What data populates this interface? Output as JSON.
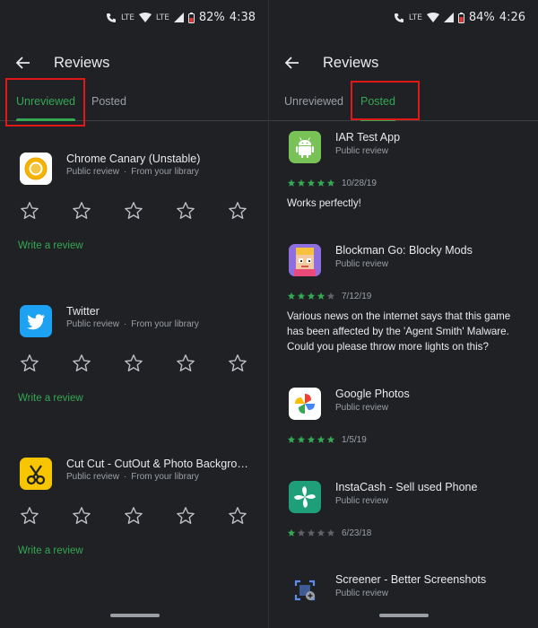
{
  "left": {
    "status": {
      "network": "LTE",
      "network2": "LTE",
      "battery": "82%",
      "time": "4:38"
    },
    "header": {
      "title": "Reviews"
    },
    "tabs": [
      {
        "label": "Unreviewed",
        "active": true
      },
      {
        "label": "Posted",
        "active": false
      }
    ],
    "items": [
      {
        "name": "Chrome Canary (Unstable)",
        "type": "Public review",
        "source": "From your library",
        "action": "Write a review",
        "icon": "chrome-canary-icon"
      },
      {
        "name": "Twitter",
        "type": "Public review",
        "source": "From your library",
        "action": "Write a review",
        "icon": "twitter-icon"
      },
      {
        "name": "Cut Cut - CutOut & Photo Background ...",
        "type": "Public review",
        "source": "From your library",
        "action": "Write a review",
        "icon": "cut-cut-icon"
      }
    ]
  },
  "right": {
    "status": {
      "network": "LTE",
      "battery": "84%",
      "time": "4:26"
    },
    "header": {
      "title": "Reviews"
    },
    "tabs": [
      {
        "label": "Unreviewed",
        "active": false
      },
      {
        "label": "Posted",
        "active": true
      }
    ],
    "items": [
      {
        "name": "IAR Test App",
        "type": "Public review",
        "rating": 5,
        "date": "10/28/19",
        "text": "Works perfectly!",
        "icon": "android-icon"
      },
      {
        "name": "Blockman Go: Blocky Mods",
        "type": "Public review",
        "rating": 4,
        "date": "7/12/19",
        "text": "Various news on the internet says that this game has been affected by the 'Agent Smith' Malware. Could you please throw more lights on this?",
        "icon": "blockman-go-icon"
      },
      {
        "name": "Google Photos",
        "type": "Public review",
        "rating": 5,
        "date": "1/5/19",
        "text": "",
        "icon": "google-photos-icon"
      },
      {
        "name": "InstaCash - Sell used Phone",
        "type": "Public review",
        "rating": 1,
        "date": "6/23/18",
        "text": "",
        "icon": "instacash-icon"
      },
      {
        "name": "Screener - Better Screenshots",
        "type": "Public review",
        "icon": "screener-icon"
      }
    ]
  },
  "colors": {
    "background": "#202124",
    "accent": "#34a853",
    "highlight_box": "#e01818",
    "star_filled": "#34a853",
    "star_empty": "#5f6368"
  }
}
